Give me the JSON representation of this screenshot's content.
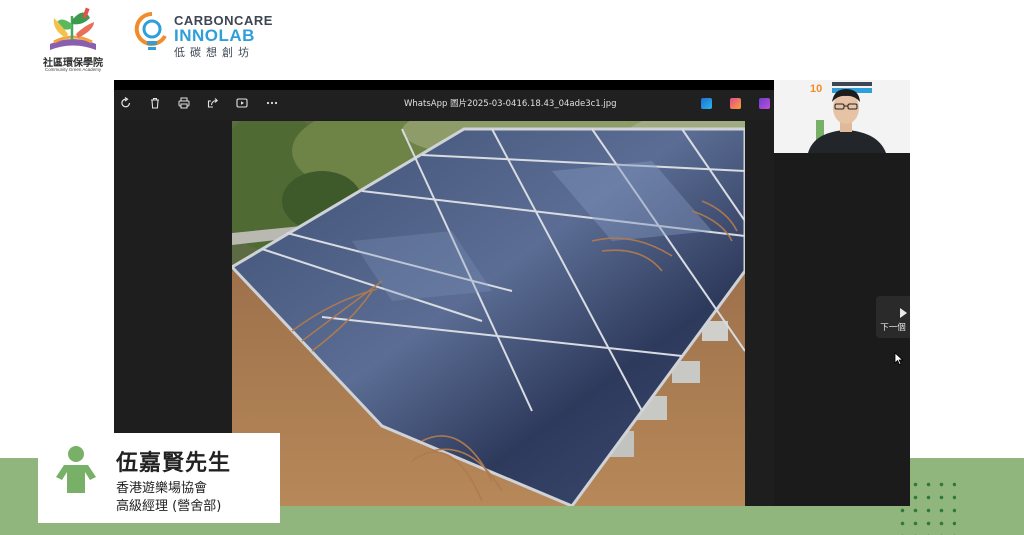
{
  "logos": {
    "academy_zh": "社區環保學院",
    "academy_en": "Community Green Academy",
    "carboncare_line1": "CARBONCARE",
    "carboncare_line2": "INNOLAB",
    "carboncare_line3": "低碳想創坊"
  },
  "viewer": {
    "filename": "WhatsApp 圖片2025-03-0416.18.43_04ade3c1.jpg",
    "toolbar_icons": [
      "rotate-icon",
      "delete-icon",
      "print-icon",
      "share-icon",
      "slideshow-icon",
      "more-icon"
    ],
    "app_icons": [
      "clipchamp-icon",
      "designer-icon",
      "video-icon"
    ],
    "next_label": "下一個"
  },
  "speaker": {
    "name": "伍嘉賢先生",
    "organization": "香港遊樂場協會",
    "title": "高級經理 (營舍部)"
  },
  "colors": {
    "band_green": "#91b67d",
    "dot_green": "#2d7a3c",
    "icon_green": "#79b067",
    "brand_blue": "#2f9fd9",
    "brand_orange": "#f28c28"
  }
}
